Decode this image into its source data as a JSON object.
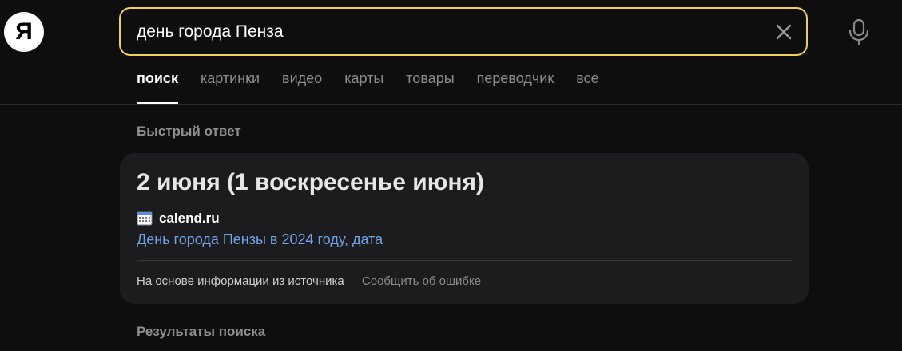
{
  "logo": {
    "letter": "Я"
  },
  "search": {
    "query": "день города Пенза"
  },
  "tabs": [
    {
      "label": "поиск",
      "active": true
    },
    {
      "label": "картинки",
      "active": false
    },
    {
      "label": "видео",
      "active": false
    },
    {
      "label": "карты",
      "active": false
    },
    {
      "label": "товары",
      "active": false
    },
    {
      "label": "переводчик",
      "active": false
    },
    {
      "label": "все",
      "active": false
    }
  ],
  "quick_answer": {
    "section_title": "Быстрый ответ",
    "answer": "2 июня (1 воскресенье июня)",
    "source_icon": "calendar-icon",
    "source_domain": "calend.ru",
    "source_link_text": "День города Пензы в 2024 году, дата",
    "based_on": "На основе информации из источника",
    "report_error": "Сообщить об ошибке"
  },
  "results": {
    "section_title": "Результаты поиска"
  },
  "colors": {
    "background": "#0e0e0f",
    "card": "#1c1c1e",
    "search_border": "#f0cf5a",
    "link": "#6fa3e6"
  }
}
